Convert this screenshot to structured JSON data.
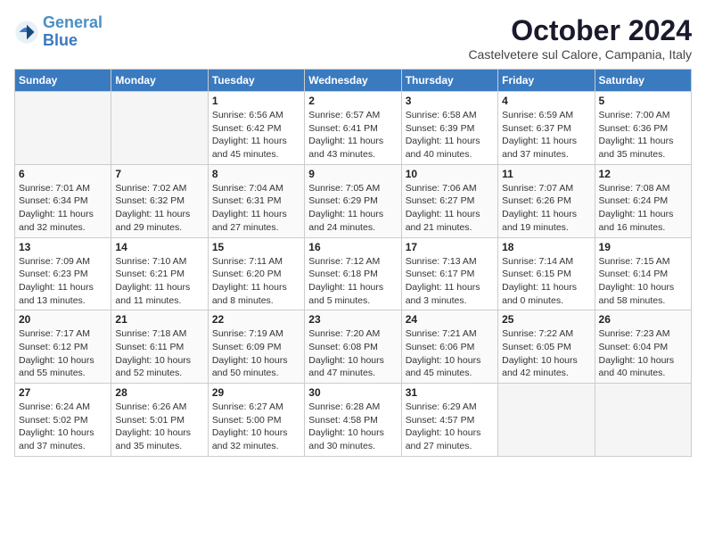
{
  "header": {
    "logo_line1": "General",
    "logo_line2": "Blue",
    "month_title": "October 2024",
    "location": "Castelvetere sul Calore, Campania, Italy"
  },
  "days_of_week": [
    "Sunday",
    "Monday",
    "Tuesday",
    "Wednesday",
    "Thursday",
    "Friday",
    "Saturday"
  ],
  "weeks": [
    [
      {
        "day": "",
        "empty": true
      },
      {
        "day": "",
        "empty": true
      },
      {
        "day": "1",
        "sunrise": "6:56 AM",
        "sunset": "6:42 PM",
        "daylight": "11 hours and 45 minutes."
      },
      {
        "day": "2",
        "sunrise": "6:57 AM",
        "sunset": "6:41 PM",
        "daylight": "11 hours and 43 minutes."
      },
      {
        "day": "3",
        "sunrise": "6:58 AM",
        "sunset": "6:39 PM",
        "daylight": "11 hours and 40 minutes."
      },
      {
        "day": "4",
        "sunrise": "6:59 AM",
        "sunset": "6:37 PM",
        "daylight": "11 hours and 37 minutes."
      },
      {
        "day": "5",
        "sunrise": "7:00 AM",
        "sunset": "6:36 PM",
        "daylight": "11 hours and 35 minutes."
      }
    ],
    [
      {
        "day": "6",
        "sunrise": "7:01 AM",
        "sunset": "6:34 PM",
        "daylight": "11 hours and 32 minutes."
      },
      {
        "day": "7",
        "sunrise": "7:02 AM",
        "sunset": "6:32 PM",
        "daylight": "11 hours and 29 minutes."
      },
      {
        "day": "8",
        "sunrise": "7:04 AM",
        "sunset": "6:31 PM",
        "daylight": "11 hours and 27 minutes."
      },
      {
        "day": "9",
        "sunrise": "7:05 AM",
        "sunset": "6:29 PM",
        "daylight": "11 hours and 24 minutes."
      },
      {
        "day": "10",
        "sunrise": "7:06 AM",
        "sunset": "6:27 PM",
        "daylight": "11 hours and 21 minutes."
      },
      {
        "day": "11",
        "sunrise": "7:07 AM",
        "sunset": "6:26 PM",
        "daylight": "11 hours and 19 minutes."
      },
      {
        "day": "12",
        "sunrise": "7:08 AM",
        "sunset": "6:24 PM",
        "daylight": "11 hours and 16 minutes."
      }
    ],
    [
      {
        "day": "13",
        "sunrise": "7:09 AM",
        "sunset": "6:23 PM",
        "daylight": "11 hours and 13 minutes."
      },
      {
        "day": "14",
        "sunrise": "7:10 AM",
        "sunset": "6:21 PM",
        "daylight": "11 hours and 11 minutes."
      },
      {
        "day": "15",
        "sunrise": "7:11 AM",
        "sunset": "6:20 PM",
        "daylight": "11 hours and 8 minutes."
      },
      {
        "day": "16",
        "sunrise": "7:12 AM",
        "sunset": "6:18 PM",
        "daylight": "11 hours and 5 minutes."
      },
      {
        "day": "17",
        "sunrise": "7:13 AM",
        "sunset": "6:17 PM",
        "daylight": "11 hours and 3 minutes."
      },
      {
        "day": "18",
        "sunrise": "7:14 AM",
        "sunset": "6:15 PM",
        "daylight": "11 hours and 0 minutes."
      },
      {
        "day": "19",
        "sunrise": "7:15 AM",
        "sunset": "6:14 PM",
        "daylight": "10 hours and 58 minutes."
      }
    ],
    [
      {
        "day": "20",
        "sunrise": "7:17 AM",
        "sunset": "6:12 PM",
        "daylight": "10 hours and 55 minutes."
      },
      {
        "day": "21",
        "sunrise": "7:18 AM",
        "sunset": "6:11 PM",
        "daylight": "10 hours and 52 minutes."
      },
      {
        "day": "22",
        "sunrise": "7:19 AM",
        "sunset": "6:09 PM",
        "daylight": "10 hours and 50 minutes."
      },
      {
        "day": "23",
        "sunrise": "7:20 AM",
        "sunset": "6:08 PM",
        "daylight": "10 hours and 47 minutes."
      },
      {
        "day": "24",
        "sunrise": "7:21 AM",
        "sunset": "6:06 PM",
        "daylight": "10 hours and 45 minutes."
      },
      {
        "day": "25",
        "sunrise": "7:22 AM",
        "sunset": "6:05 PM",
        "daylight": "10 hours and 42 minutes."
      },
      {
        "day": "26",
        "sunrise": "7:23 AM",
        "sunset": "6:04 PM",
        "daylight": "10 hours and 40 minutes."
      }
    ],
    [
      {
        "day": "27",
        "sunrise": "6:24 AM",
        "sunset": "5:02 PM",
        "daylight": "10 hours and 37 minutes."
      },
      {
        "day": "28",
        "sunrise": "6:26 AM",
        "sunset": "5:01 PM",
        "daylight": "10 hours and 35 minutes."
      },
      {
        "day": "29",
        "sunrise": "6:27 AM",
        "sunset": "5:00 PM",
        "daylight": "10 hours and 32 minutes."
      },
      {
        "day": "30",
        "sunrise": "6:28 AM",
        "sunset": "4:58 PM",
        "daylight": "10 hours and 30 minutes."
      },
      {
        "day": "31",
        "sunrise": "6:29 AM",
        "sunset": "4:57 PM",
        "daylight": "10 hours and 27 minutes."
      },
      {
        "day": "",
        "empty": true
      },
      {
        "day": "",
        "empty": true
      }
    ]
  ]
}
